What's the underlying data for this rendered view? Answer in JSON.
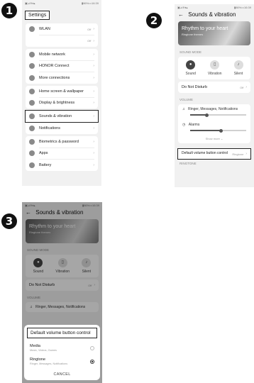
{
  "steps": [
    "1",
    "2",
    "3"
  ],
  "status": {
    "left": "▣⊿≋♦▴",
    "right": "▮86%▭16:39"
  },
  "screen1": {
    "title": "Settings",
    "items": [
      {
        "label": "WLAN",
        "value": "Off",
        "icon": "wifi-icon"
      },
      {
        "label": "",
        "value": "Off",
        "icon": ""
      },
      {
        "label": "Mobile network",
        "value": "",
        "icon": "signal-icon"
      },
      {
        "label": "HONOR Connect",
        "value": "",
        "icon": "connect-icon"
      },
      {
        "label": "More connections",
        "value": "",
        "icon": "link-icon"
      },
      {
        "label": "Home screen & wallpaper",
        "value": "",
        "icon": "image-icon"
      },
      {
        "label": "Display & brightness",
        "value": "",
        "icon": "brightness-icon"
      },
      {
        "label": "Sounds & vibration",
        "value": "",
        "icon": "speaker-icon"
      },
      {
        "label": "Notifications",
        "value": "",
        "icon": "bell-icon"
      },
      {
        "label": "Biometrics & password",
        "value": "",
        "icon": "key-icon"
      },
      {
        "label": "Apps",
        "value": "",
        "icon": "apps-icon"
      },
      {
        "label": "Battery",
        "value": "",
        "icon": "battery-icon"
      }
    ]
  },
  "sounds": {
    "back": "←",
    "title": "Sounds & vibration",
    "banner_title": "Rhythm to your heart",
    "banner_subtitle": "Ringtone themes",
    "sound_mode_label": "SOUND MODE",
    "modes": [
      {
        "label": "Sound",
        "glyph": "🔔"
      },
      {
        "label": "Vibration",
        "glyph": "⌗"
      },
      {
        "label": "Silent",
        "glyph": "🔕"
      }
    ],
    "dnd_label": "Do Not Disturb",
    "dnd_value": "Off",
    "volume_label": "VOLUME",
    "ringer_label": "Ringer, Messages, Notifications",
    "ringer_level": 0.3,
    "alarms_label": "Alarms",
    "alarms_level": 0.55,
    "show_more": "Show more",
    "default_btn_label": "Default volume button control",
    "default_btn_value": "Ringtone",
    "ringtone_section": "RINGTONE"
  },
  "dialog": {
    "title": "Default volume button control",
    "options": [
      {
        "label": "Media",
        "sub": "Music, Videos, Games",
        "selected": false
      },
      {
        "label": "Ringtone",
        "sub": "Ringer, Messages, Notifications",
        "selected": true
      }
    ],
    "cancel": "CANCEL"
  },
  "colors": {
    "accent": "#222222",
    "background": "#f1f1f1"
  }
}
